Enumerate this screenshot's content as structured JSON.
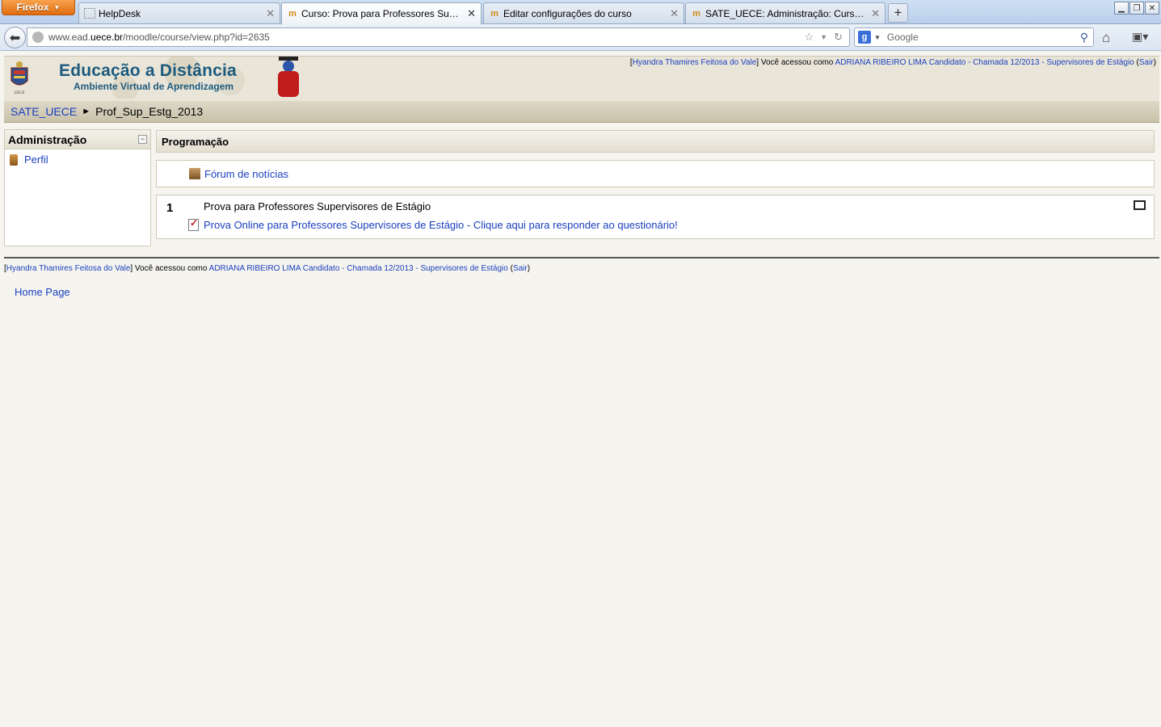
{
  "browser": {
    "menu_label": "Firefox",
    "tabs": [
      {
        "label": "HelpDesk",
        "icon": "blank-page-icon"
      },
      {
        "label": "Curso: Prova para Professores Supervi...",
        "icon": "moodle-icon"
      },
      {
        "label": "Editar configurações do curso",
        "icon": "moodle-icon"
      },
      {
        "label": "SATE_UECE: Administração: Cursos: ...",
        "icon": "moodle-icon"
      }
    ],
    "url_prefix": "www.ead.",
    "url_host": "uece.br",
    "url_path": "/moodle/course/view.php?id=2635",
    "search_placeholder": "Google"
  },
  "header": {
    "title": "Educação a Distância",
    "subtitle": "Ambiente Virtual de Aprendizagem",
    "crest_label": "UECE",
    "login": {
      "open": "[",
      "real_user": "Hyandra Thamires Feitosa do Vale",
      "mid": "] Você acessou como ",
      "as_user": "ADRIANA RIBEIRO LIMA Candidato - Chamada 12/2013 - Supervisores de Estágio",
      "logout_open": " (",
      "logout": "Sair",
      "logout_close": ")"
    }
  },
  "breadcrumb": {
    "home": "SATE_UECE",
    "separator": "►",
    "current": "Prof_Sup_Estg_2013"
  },
  "admin_block": {
    "title": "Administração",
    "collapse": "−",
    "items": [
      {
        "label": "Perfil"
      }
    ]
  },
  "main": {
    "heading": "Programação",
    "forum_link": "Fórum de notícias",
    "section1": {
      "number": "1",
      "title": "Prova para Professores Supervisores de Estágio",
      "quiz_link": "Prova Online para Professores Supervisores de Estágio - Clique aqui para responder ao questionário!"
    }
  },
  "footer": {
    "home_page": "Home Page"
  }
}
